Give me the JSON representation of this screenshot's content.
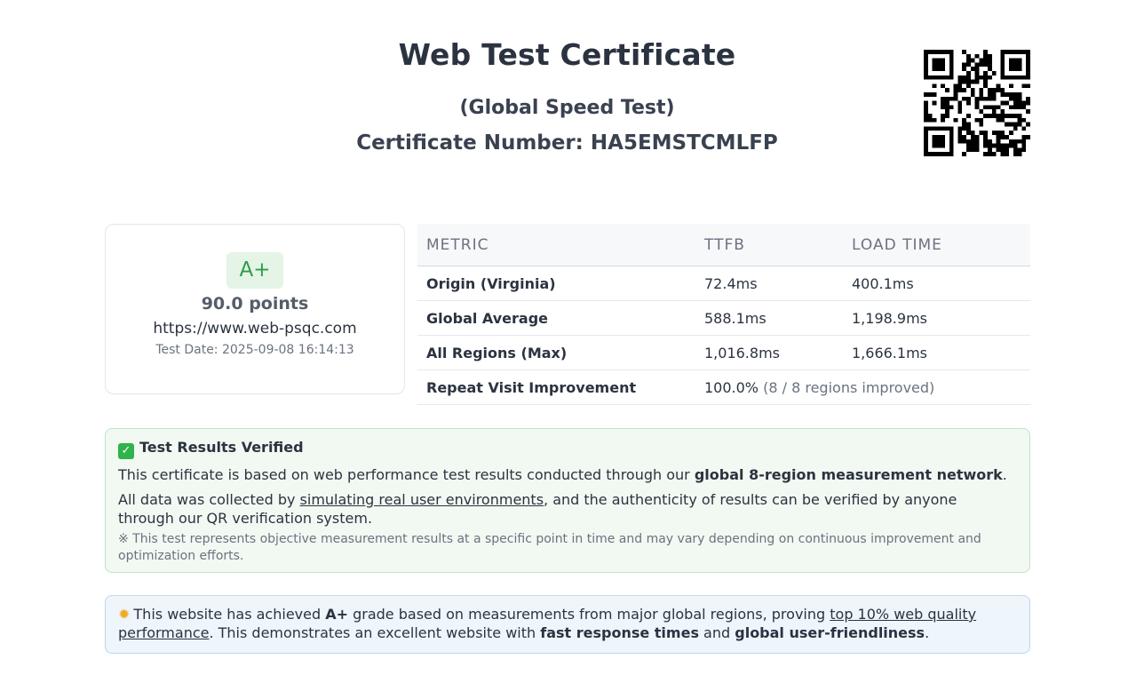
{
  "header": {
    "title": "Web Test Certificate",
    "subtitle": "(Global Speed Test)",
    "certificate_number": "Certificate Number: HA5EMSTCMLFP"
  },
  "score": {
    "grade": "A+",
    "points": "90.0 points",
    "url": "https://www.web-psqc.com",
    "test_date": "Test Date: 2025-09-08 16:14:13"
  },
  "metrics": {
    "headers": [
      "METRIC",
      "TTFB",
      "LOAD TIME"
    ],
    "rows": [
      {
        "label": "Origin (Virginia)",
        "ttfb": "72.4ms",
        "load": "400.1ms"
      },
      {
        "label": "Global Average",
        "ttfb": "588.1ms",
        "load": "1,198.9ms"
      },
      {
        "label": "All Regions (Max)",
        "ttfb": "1,016.8ms",
        "load": "1,666.1ms"
      }
    ],
    "repeat": {
      "label": "Repeat Visit Improvement",
      "value": "100.0%",
      "detail": "(8 / 8 regions improved)"
    }
  },
  "verified": {
    "icon": "check-mark-icon",
    "title": "Test Results Verified",
    "line1_pre": "This certificate is based on web performance test results conducted through our ",
    "line1_bold": "global 8-region measurement network",
    "line1_post": ".",
    "line2_pre": "All data was collected by ",
    "line2_link": "simulating real user environments",
    "line2_post": ", and the authenticity of results can be verified by anyone through our QR verification system.",
    "note": "※ This test represents objective measurement results at a specific point in time and may vary depending on continuous improvement and optimization efforts."
  },
  "achievement": {
    "icon": "star-icon",
    "t1": "This website has achieved ",
    "grade": "A+",
    "t2": " grade based on measurements from major global regions, proving ",
    "link": "top 10% web quality performance",
    "t3": ". This demonstrates an excellent website with ",
    "b1": "fast response times",
    "t4": " and ",
    "b2": "global user-friendliness",
    "t5": "."
  },
  "colors": {
    "grade_green": "#2f9c4a",
    "verified_bg": "#f1f9f2",
    "achievement_bg": "#eef5fb"
  }
}
